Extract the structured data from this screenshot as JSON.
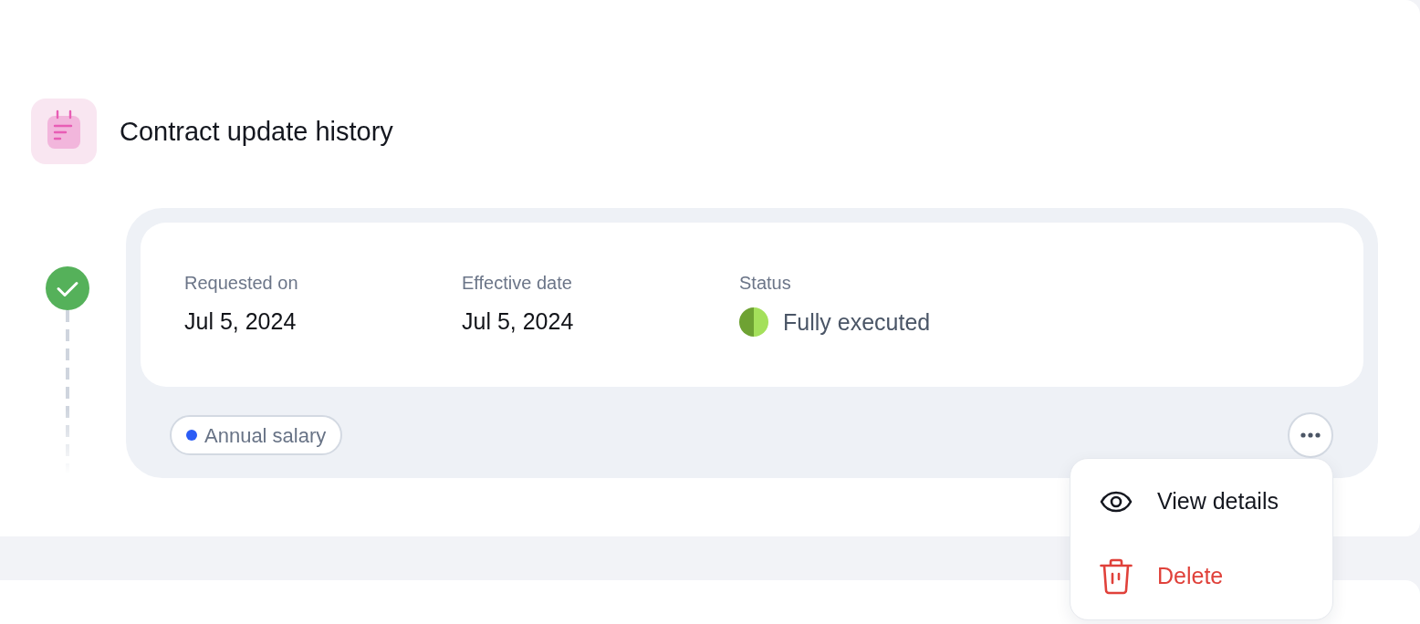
{
  "header": {
    "title": "Contract update history"
  },
  "entries": [
    {
      "completed": true,
      "fields": [
        {
          "kind": "date",
          "label": "Requested on",
          "value": "Jul 5, 2024"
        },
        {
          "kind": "date",
          "label": "Effective date",
          "value": "Jul 5, 2024"
        },
        {
          "kind": "status",
          "label": "Status",
          "value": "Fully executed"
        }
      ],
      "tags": [
        {
          "label": "Annual salary",
          "color": "#2b5cf5"
        }
      ],
      "menu": {
        "open": true,
        "items": [
          {
            "kind": "view",
            "label": "View details"
          },
          {
            "kind": "danger",
            "label": "Delete"
          }
        ]
      }
    }
  ]
}
